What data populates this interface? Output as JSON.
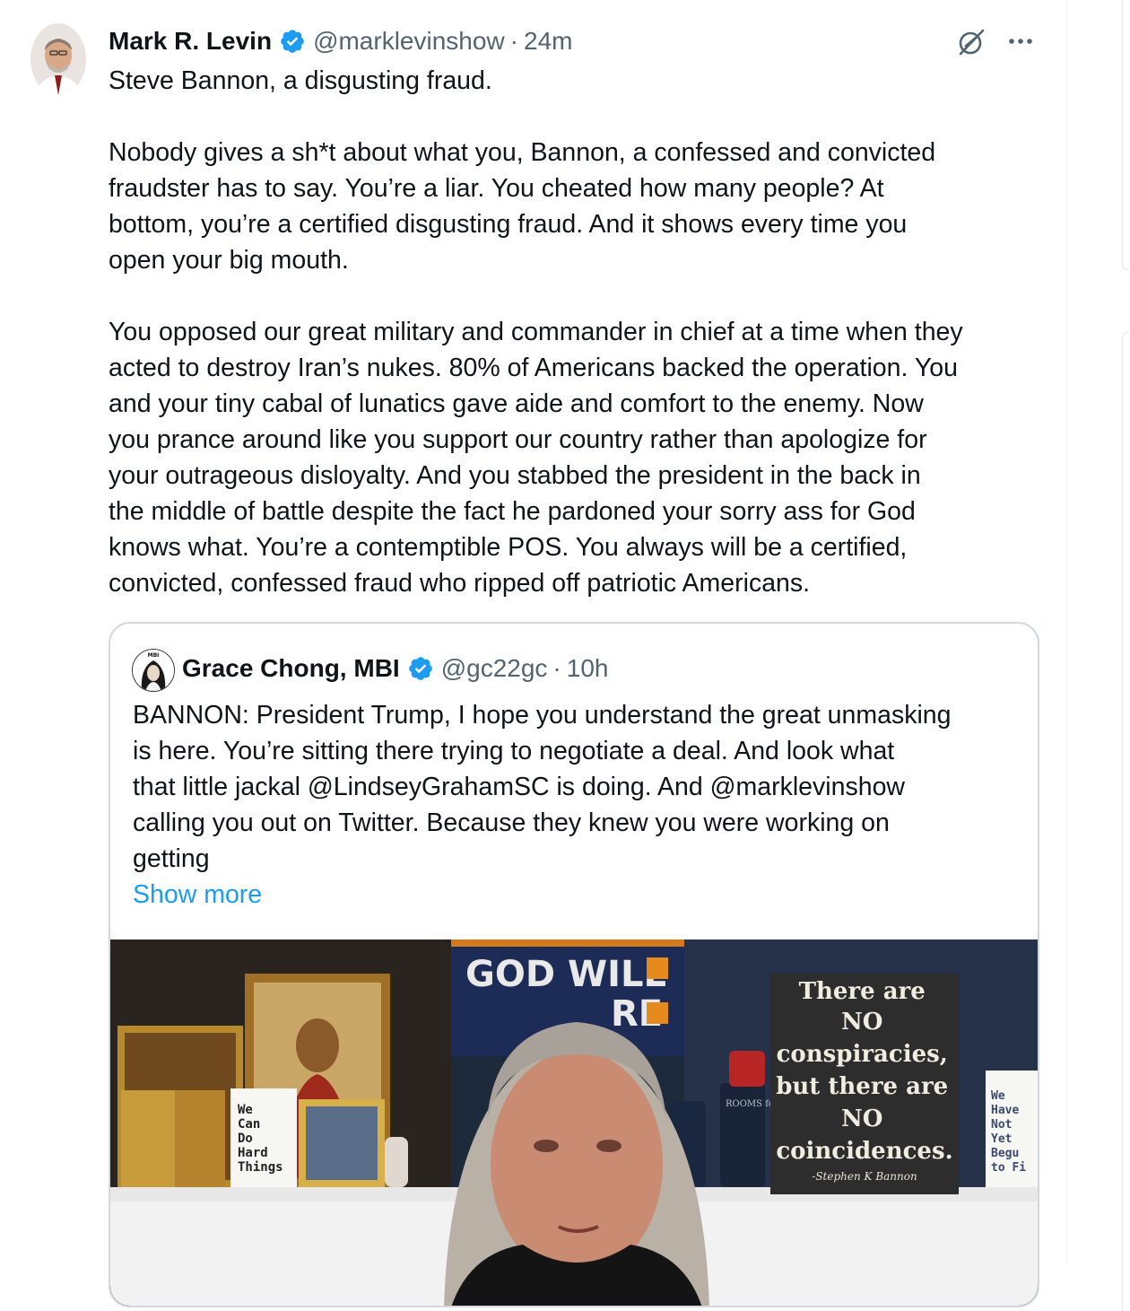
{
  "tweet": {
    "author_name": "Mark R. Levin",
    "author_handle": "@marklevinshow",
    "separator": "·",
    "time": "24m",
    "text_lines": [
      "Steve Bannon, a disgusting fraud.",
      "",
      "Nobody gives a sh*t about what you, Bannon, a confessed and convicted",
      "fraudster has to say. You’re a liar. You cheated how many people?  At",
      "bottom, you’re a certified disgusting fraud. And it shows every time you",
      "open your big mouth.",
      "",
      "You opposed our great military and commander in chief at a time when they",
      "acted to destroy Iran’s nukes. 80% of Americans backed the operation. You",
      "and your tiny cabal of lunatics gave aide and comfort to the enemy. Now",
      "you prance around like you support our country rather than apologize for",
      "your outrageous disloyalty. And you stabbed the president in the back in",
      "the middle of battle despite the fact he pardoned your sorry ass for God",
      "knows what. You’re a contemptible POS. You always will be a certified,",
      "convicted, confessed fraud who ripped off patriotic Americans."
    ]
  },
  "quote": {
    "author_name": "Grace Chong, MBI",
    "author_handle": "@gc22gc",
    "separator": "·",
    "time": "10h",
    "avatar_label": "MBI",
    "text_lines": [
      "BANNON: President Trump, I hope you understand the great unmasking",
      "is here. You’re sitting there trying to negotiate a deal. And look what",
      "that little jackal @LindseyGrahamSC is doing. And @marklevinshow",
      "calling you out on Twitter. Because they knew you were working on",
      "getting"
    ],
    "show_more": "Show more",
    "media": {
      "banner_line1": "GOD WILL",
      "banner_line2": "RE",
      "sign_lines": [
        "There are",
        "NO",
        "conspiracies,",
        "but there are",
        "NO",
        "coincidences."
      ],
      "sign_signature": "-Stephen K Bannon",
      "card_lines": [
        "We",
        "Can",
        "Do",
        "Hard",
        "Things"
      ],
      "card2_lines": [
        "We",
        "Have",
        "Not",
        "Yet",
        "Begu",
        "to Fi"
      ],
      "tumbler_text": "ROOMS for LIBERTY"
    }
  },
  "colors": {
    "text_primary": "#0f1419",
    "text_secondary": "#536471",
    "link": "#1d9bf0",
    "verified": "#1d9bf0",
    "border": "#cfd9de"
  },
  "icons": [
    "verified-badge-icon",
    "grok-icon",
    "more-options-icon"
  ]
}
